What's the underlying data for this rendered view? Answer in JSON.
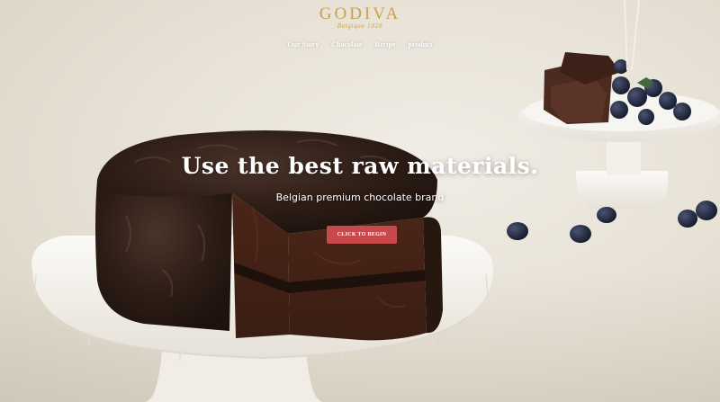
{
  "brand": {
    "name": "GODIVA",
    "tagline": "Belgique 1926"
  },
  "nav": {
    "items": [
      {
        "label": "Our Story"
      },
      {
        "label": "Chocolate"
      },
      {
        "label": "Recipe"
      },
      {
        "label": "product"
      }
    ]
  },
  "hero": {
    "headline": "Use the best raw materials.",
    "subheadline": "Belgian premium chocolate brand",
    "cta_label": "CLICK TO BEGIN"
  },
  "colors": {
    "logo_gold": "#c9a24a",
    "cta_red": "#c9484c",
    "chocolate": "#2e1d16"
  },
  "icons": {
    "cake": "chocolate-cake-image",
    "dessert_stand": "chocolate-blueberry-stand-image"
  }
}
